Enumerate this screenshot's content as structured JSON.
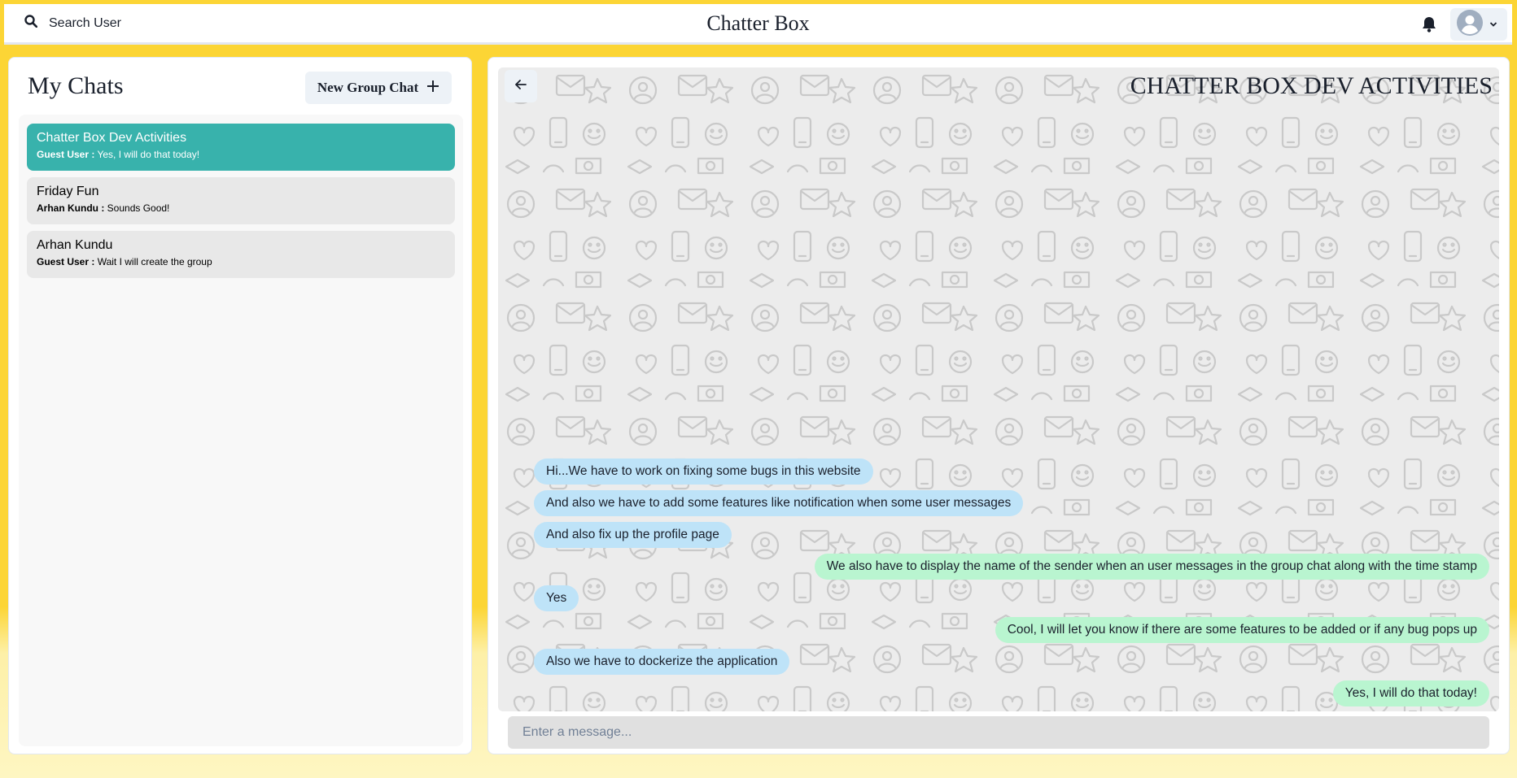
{
  "header": {
    "search_label": "Search User",
    "app_title": "Chatter Box",
    "bell_icon": "bell-icon",
    "avatar_icon": "user-avatar-icon"
  },
  "sidebar": {
    "title": "My Chats",
    "new_group_label": "New Group Chat",
    "chats": [
      {
        "name": "Chatter Box Dev Activities",
        "sender": "Guest User :",
        "latest": "Yes, I will do that today!",
        "active": true
      },
      {
        "name": "Friday Fun",
        "sender": "Arhan Kundu :",
        "latest": "Sounds Good!",
        "active": false
      },
      {
        "name": "Arhan Kundu",
        "sender": "Guest User :",
        "latest": "Wait I will create the group",
        "active": false
      }
    ]
  },
  "chat": {
    "title": "CHATTER BOX DEV ACTIVITIES",
    "messages": [
      {
        "text": "Hi...We have to work on fixing some bugs in this website",
        "from_me": false
      },
      {
        "text": "And also we have to add some features like notification when some user messages",
        "from_me": false
      },
      {
        "text": "And also fix up the profile page",
        "from_me": false
      },
      {
        "text": "We also have to display the name of the sender when an user messages in the group chat along with the time stamp",
        "from_me": true
      },
      {
        "text": "Yes",
        "from_me": false
      },
      {
        "text": "Cool, I will let you know if there are some features to be added or if any bug pops up",
        "from_me": true
      },
      {
        "text": "Also we have to dockerize the application",
        "from_me": false
      },
      {
        "text": "Yes, I will do that today!",
        "from_me": true
      }
    ],
    "input_placeholder": "Enter a message..."
  },
  "colors": {
    "background": "#fcd535",
    "active_chat": "#38b2ac",
    "bubble_them": "#bee3f8",
    "bubble_me": "#b9f5d0"
  }
}
